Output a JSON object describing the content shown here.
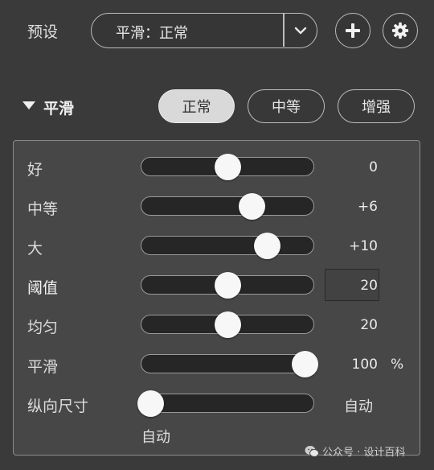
{
  "preset": {
    "label": "预设",
    "value": "平滑：正常"
  },
  "section": {
    "title": "平滑",
    "modes": [
      "正常",
      "中等",
      "增强"
    ],
    "active_mode": "正常"
  },
  "sliders": [
    {
      "label": "好",
      "value": "0",
      "level": 0.5
    },
    {
      "label": "中等",
      "value": "+6",
      "level": 0.64
    },
    {
      "label": "大",
      "value": "+10",
      "level": 0.73
    },
    {
      "label": "阈值",
      "value": "20",
      "level": 0.5
    },
    {
      "label": "均匀",
      "value": "20",
      "level": 0.5
    },
    {
      "label": "平滑",
      "value": "100",
      "unit": "%",
      "level": 1.0
    },
    {
      "label": "纵向尺寸",
      "value": "自动",
      "level": 0.0
    }
  ],
  "vertical_size_hint": "自动",
  "watermark": "公众号 · 设计百科",
  "icons": {
    "dropdown": "chevron-down-icon",
    "add": "plus-icon",
    "settings": "gear-icon",
    "collapse": "triangle-down-icon",
    "watermark": "wechat-icon"
  }
}
